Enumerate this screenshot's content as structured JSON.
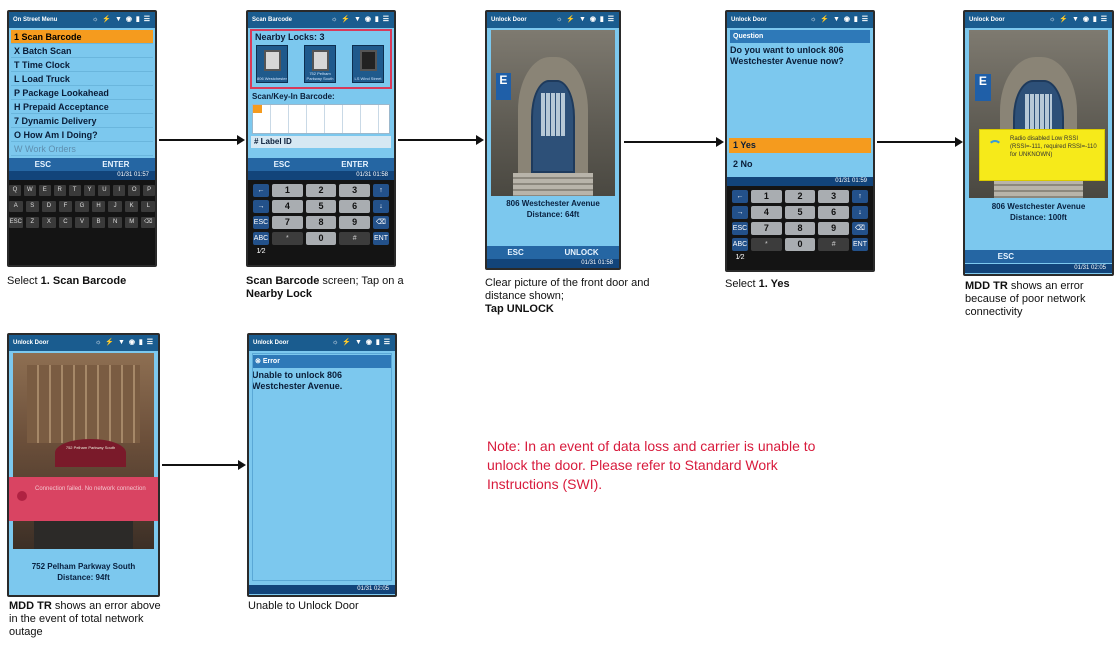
{
  "p1": {
    "title": "On Street Menu",
    "items": [
      "1 Scan Barcode",
      "X Batch Scan",
      "T Time Clock",
      "L Load Truck",
      "P Package Lookahead",
      "H Prepaid Acceptance",
      "7 Dynamic Delivery",
      "O How Am I Doing?",
      "W Work Orders"
    ],
    "esc": "ESC",
    "enter": "ENTER",
    "time": "01/31 01:57",
    "caption_pre": "Select ",
    "caption_bold": "1. Scan Barcode",
    "keys_row1": [
      "Q",
      "W",
      "E",
      "R",
      "T",
      "Y",
      "U",
      "I",
      "O",
      "P"
    ],
    "keys_row2": [
      "A",
      "S",
      "D",
      "F",
      "G",
      "H",
      "J",
      "K",
      "L"
    ],
    "keys_row3": [
      "ESC",
      "Z",
      "X",
      "C",
      "V",
      "B",
      "N",
      "M",
      "⌫"
    ]
  },
  "p2": {
    "title": "Scan Barcode",
    "nearby_locks": "Nearby Locks: 3",
    "lock1": "806 Westchester",
    "lock2": "752 Pelham Parkway South",
    "lock3": "LS Wind Street",
    "scan_label": "Scan/Key-In Barcode:",
    "label_id": "#   Label ID",
    "esc": "ESC",
    "enter": "ENTER",
    "time": "01/31 01:58",
    "caption_bold1": "Scan Barcode",
    "caption_mid": " screen; Tap on a ",
    "caption_bold2": "Nearby Lock"
  },
  "p3": {
    "title": "Unlock Door",
    "sign": "E",
    "address": "806 Westchester Avenue",
    "distance": "Distance: 64ft",
    "esc": "ESC",
    "unlock": "UNLOCK",
    "time": "01/31 01:58",
    "caption": "Clear picture of the front door and distance shown;",
    "caption_bold": "Tap UNLOCK"
  },
  "p4": {
    "title": "Unlock Door",
    "q_header": "Question",
    "question": "Do you want to unlock 806 Westchester Avenue now?",
    "opt1": "1  Yes",
    "opt2": "2  No",
    "time": "01/31 01:59",
    "caption_pre": "Select ",
    "caption_bold": "1. Yes"
  },
  "p5": {
    "title": "Unlock Door",
    "sign": "E",
    "warn": "Radio disabled Low RSSI (RSSI=-111, required RSSI=-110 for UNKNOWN)",
    "address": "806 Westchester Avenue",
    "distance": "Distance: 100ft",
    "esc": "ESC",
    "time": "01/31 02:05",
    "caption_bold": "MDD TR",
    "caption_rest": " shows an error because of poor network connectivity"
  },
  "p6": {
    "title": "Unlock Door",
    "awning": "752 Pelham Parkway South",
    "error_bar": "Connection failed. No network connection",
    "address": "752 Pelham Parkway South",
    "distance": "Distance: 94ft",
    "caption_bold": "MDD TR",
    "caption_rest": " shows an error above in the event of total network outage"
  },
  "p7": {
    "title": "Unlock Door",
    "e_header": "Error",
    "error_msg": "Unable to unlock 806 Westchester Avenue.",
    "time": "01/31 02:05",
    "caption": "Unable to Unlock Door"
  },
  "numpad": [
    "←",
    "1",
    "2",
    "3",
    "↑",
    "→",
    "4",
    "5",
    "6",
    "↓",
    "ESC",
    "7",
    "8",
    "9",
    "⌫",
    "ABC 1⁄2",
    "*",
    "0",
    "#",
    "ENT"
  ],
  "note": "Note: In an event of data loss and carrier is unable to unlock the door. Please refer to Standard Work Instructions (SWI).",
  "status_icons": "☼ ⚡ ▼ ◉ ▮ ☰",
  "colors": {
    "screen": "#7cc8ee",
    "selected": "#f59b1e",
    "header": "#1a5c8f",
    "note": "#d81b3c",
    "warn": "#f6ea1a",
    "error_bar": "#d94462"
  }
}
